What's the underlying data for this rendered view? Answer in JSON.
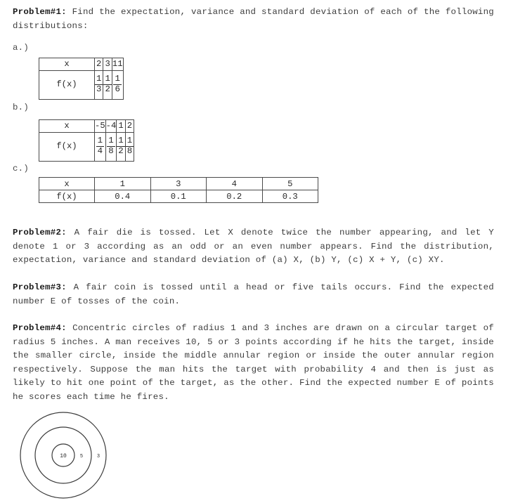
{
  "document": {
    "problems": [
      {
        "label": "Problem#1:",
        "text": " Find the expectation, variance and standard deviation of each of the following distributions:"
      },
      {
        "label": "Problem#2:",
        "text": " A fair die is tossed. Let X denote twice the number appearing, and let Y denote 1 or 3 according as an odd or an even number appears. Find the distribution, expectation, variance and standard deviation of (a) X, (b) Y, (c) X + Y, (c) XY."
      },
      {
        "label": "Problem#3:",
        "text": " A fair coin is tossed until a head or five tails occurs. Find the expected number E of tosses of the coin."
      },
      {
        "label": "Problem#4:",
        "text": " Concentric circles of radius 1 and 3 inches are drawn on a circular target of radius 5 inches. A man receives 10, 5 or 3 points according if he hits the target, inside the smaller circle, inside the middle annular region or inside the outer annular region respectively. Suppose the man hits the target with probability 4 and then is just as likely to hit one point of the target, as the other. Find the expected number E of points he scores each time he fires."
      }
    ],
    "part_labels": {
      "a": "a.)",
      "b": "b.)",
      "c": "c.)"
    },
    "tables": {
      "a": {
        "row_headers": [
          "x",
          "f(x)"
        ],
        "x_values": [
          "2",
          "3",
          "11"
        ],
        "f_values": [
          {
            "num": "1",
            "den": "3"
          },
          {
            "num": "1",
            "den": "2"
          },
          {
            "num": "1",
            "den": "6"
          }
        ]
      },
      "b": {
        "row_headers": [
          "x",
          "f(x)"
        ],
        "x_values": [
          "-5",
          "-4",
          "1",
          "2"
        ],
        "f_values": [
          {
            "num": "1",
            "den": "4"
          },
          {
            "num": "1",
            "den": "8"
          },
          {
            "num": "1",
            "den": "2"
          },
          {
            "num": "1",
            "den": "8"
          }
        ]
      },
      "c": {
        "row_headers": [
          "x",
          "f(x)"
        ],
        "x_values": [
          "1",
          "3",
          "4",
          "5"
        ],
        "f_values": [
          "0.4",
          "0.1",
          "0.2",
          "0.3"
        ]
      }
    },
    "figure": {
      "name": "concentric-target-diagram",
      "labels": {
        "inner": "10",
        "middle": "5",
        "outer": "3"
      },
      "stroke_color": "#3a3a3a"
    }
  }
}
